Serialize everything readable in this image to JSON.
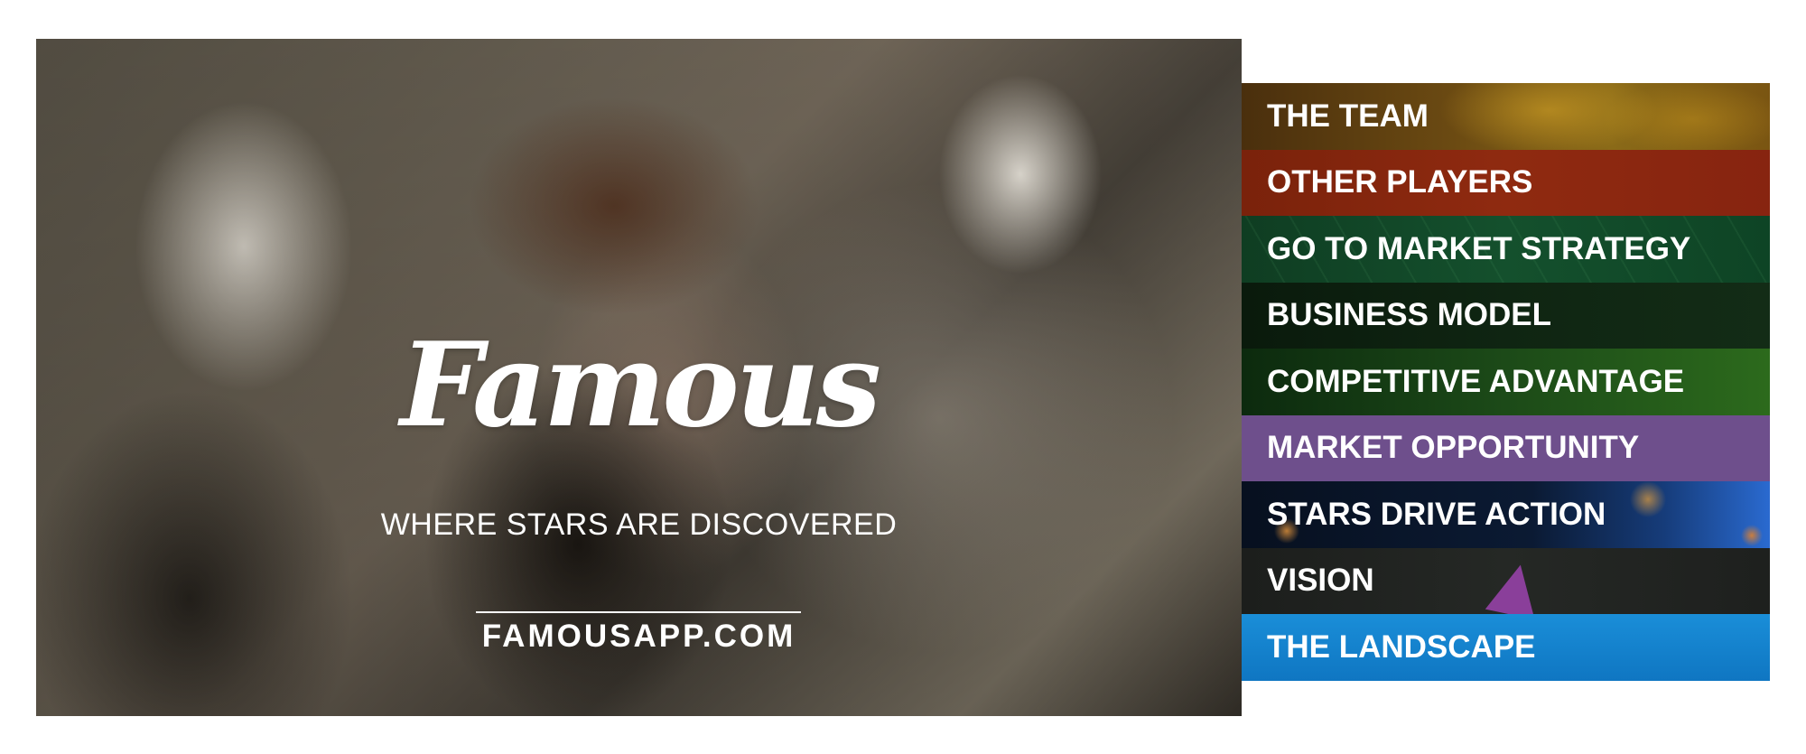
{
  "hero": {
    "logo": "Famous",
    "tagline": "WHERE STARS ARE DISCOVERED",
    "url": "FAMOUSAPP.COM"
  },
  "menu": {
    "items": [
      {
        "label": "THE TEAM",
        "color": "#6b4a12"
      },
      {
        "label": "OTHER PLAYERS",
        "color": "#8f2a10"
      },
      {
        "label": "GO TO MARKET STRATEGY",
        "color": "#14502d"
      },
      {
        "label": "BUSINESS MODEL",
        "color": "#0f2512"
      },
      {
        "label": "COMPETITIVE ADVANTAGE",
        "color": "#1c4a18"
      },
      {
        "label": "MARKET OPPORTUNITY",
        "color": "#6e4f8c"
      },
      {
        "label": "STARS DRIVE ACTION",
        "color": "#0b1a33"
      },
      {
        "label": "VISION",
        "color": "#252825"
      },
      {
        "label": "THE LANDSCAPE",
        "color": "#1a8ed8"
      }
    ]
  }
}
